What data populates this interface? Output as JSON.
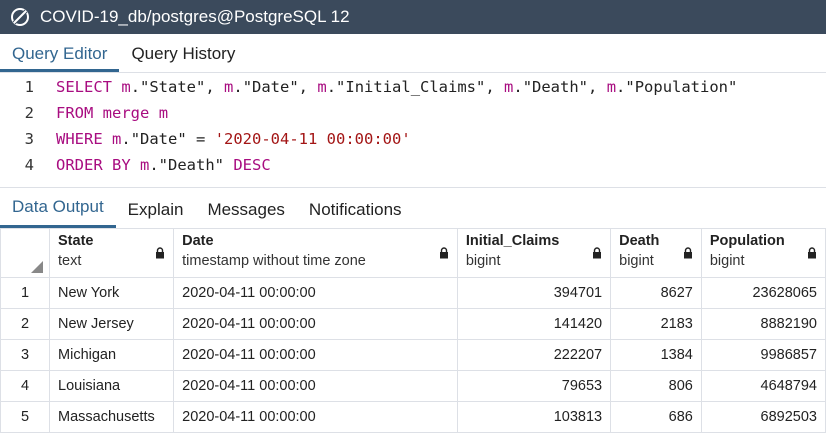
{
  "window": {
    "title": "COVID-19_db/postgres@PostgreSQL 12"
  },
  "top_tabs": [
    {
      "label": "Query Editor"
    },
    {
      "label": "Query History"
    }
  ],
  "editor": {
    "line_numbers": [
      "1",
      "2",
      "3",
      "4"
    ],
    "l1": {
      "kw1": "SELECT",
      "t1": " ",
      "a1": "m",
      "t2": ".\"State\", ",
      "a2": "m",
      "t3": ".\"Date\", ",
      "a3": "m",
      "t4": ".\"Initial_Claims\", ",
      "a4": "m",
      "t5": ".\"Death\", ",
      "a5": "m",
      "t6": ".\"Population\""
    },
    "l2": {
      "kw1": "FROM",
      "t1": " ",
      "kw2": "merge",
      "t2": " ",
      "kw3": "m"
    },
    "l3": {
      "kw1": "WHERE",
      "t1": " ",
      "a1": "m",
      "t2": ".\"Date\" = ",
      "s1": "'2020-04-11 00:00:00'"
    },
    "l4": {
      "kw1": "ORDER BY",
      "t1": " ",
      "a1": "m",
      "t2": ".\"Death\" ",
      "kw2": "DESC"
    }
  },
  "output_tabs": [
    {
      "label": "Data Output"
    },
    {
      "label": "Explain"
    },
    {
      "label": "Messages"
    },
    {
      "label": "Notifications"
    }
  ],
  "columns": [
    {
      "name": "State",
      "type": "text"
    },
    {
      "name": "Date",
      "type": "timestamp without time zone"
    },
    {
      "name": "Initial_Claims",
      "type": "bigint"
    },
    {
      "name": "Death",
      "type": "bigint"
    },
    {
      "name": "Population",
      "type": "bigint"
    }
  ],
  "rows": [
    [
      "1",
      "New York",
      "2020-04-11 00:00:00",
      "394701",
      "8627",
      "23628065"
    ],
    [
      "2",
      "New Jersey",
      "2020-04-11 00:00:00",
      "141420",
      "2183",
      "8882190"
    ],
    [
      "3",
      "Michigan",
      "2020-04-11 00:00:00",
      "222207",
      "1384",
      "9986857"
    ],
    [
      "4",
      "Louisiana",
      "2020-04-11 00:00:00",
      "79653",
      "806",
      "4648794"
    ],
    [
      "5",
      "Massachusetts",
      "2020-04-11 00:00:00",
      "103813",
      "686",
      "6892503"
    ]
  ],
  "colors": {
    "titlebar": "#3b4a5c",
    "accent": "#326690",
    "keyword": "#a80c80",
    "string": "#a31515"
  },
  "icons": {
    "app": "pgadmin-logo-icon",
    "lock": "lock-icon",
    "select_all": "select-all-triangle-icon"
  }
}
